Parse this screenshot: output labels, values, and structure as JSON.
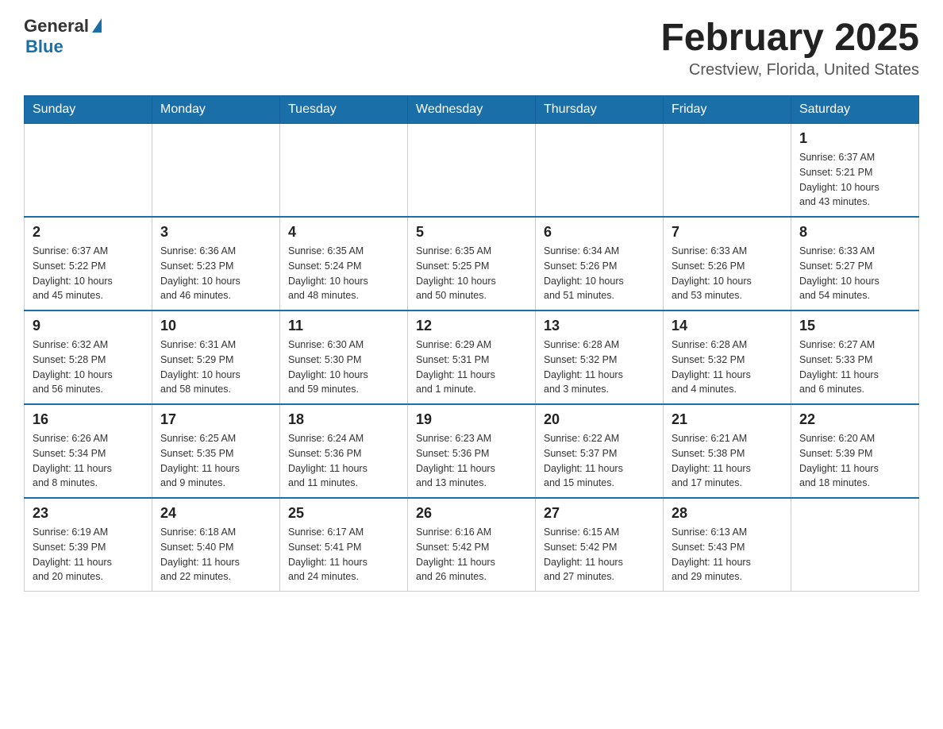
{
  "header": {
    "logo_general": "General",
    "logo_blue": "Blue",
    "month_title": "February 2025",
    "location": "Crestview, Florida, United States"
  },
  "weekdays": [
    "Sunday",
    "Monday",
    "Tuesday",
    "Wednesday",
    "Thursday",
    "Friday",
    "Saturday"
  ],
  "rows": [
    {
      "cells": [
        {
          "day": "",
          "info": ""
        },
        {
          "day": "",
          "info": ""
        },
        {
          "day": "",
          "info": ""
        },
        {
          "day": "",
          "info": ""
        },
        {
          "day": "",
          "info": ""
        },
        {
          "day": "",
          "info": ""
        },
        {
          "day": "1",
          "info": "Sunrise: 6:37 AM\nSunset: 5:21 PM\nDaylight: 10 hours\nand 43 minutes."
        }
      ]
    },
    {
      "cells": [
        {
          "day": "2",
          "info": "Sunrise: 6:37 AM\nSunset: 5:22 PM\nDaylight: 10 hours\nand 45 minutes."
        },
        {
          "day": "3",
          "info": "Sunrise: 6:36 AM\nSunset: 5:23 PM\nDaylight: 10 hours\nand 46 minutes."
        },
        {
          "day": "4",
          "info": "Sunrise: 6:35 AM\nSunset: 5:24 PM\nDaylight: 10 hours\nand 48 minutes."
        },
        {
          "day": "5",
          "info": "Sunrise: 6:35 AM\nSunset: 5:25 PM\nDaylight: 10 hours\nand 50 minutes."
        },
        {
          "day": "6",
          "info": "Sunrise: 6:34 AM\nSunset: 5:26 PM\nDaylight: 10 hours\nand 51 minutes."
        },
        {
          "day": "7",
          "info": "Sunrise: 6:33 AM\nSunset: 5:26 PM\nDaylight: 10 hours\nand 53 minutes."
        },
        {
          "day": "8",
          "info": "Sunrise: 6:33 AM\nSunset: 5:27 PM\nDaylight: 10 hours\nand 54 minutes."
        }
      ]
    },
    {
      "cells": [
        {
          "day": "9",
          "info": "Sunrise: 6:32 AM\nSunset: 5:28 PM\nDaylight: 10 hours\nand 56 minutes."
        },
        {
          "day": "10",
          "info": "Sunrise: 6:31 AM\nSunset: 5:29 PM\nDaylight: 10 hours\nand 58 minutes."
        },
        {
          "day": "11",
          "info": "Sunrise: 6:30 AM\nSunset: 5:30 PM\nDaylight: 10 hours\nand 59 minutes."
        },
        {
          "day": "12",
          "info": "Sunrise: 6:29 AM\nSunset: 5:31 PM\nDaylight: 11 hours\nand 1 minute."
        },
        {
          "day": "13",
          "info": "Sunrise: 6:28 AM\nSunset: 5:32 PM\nDaylight: 11 hours\nand 3 minutes."
        },
        {
          "day": "14",
          "info": "Sunrise: 6:28 AM\nSunset: 5:32 PM\nDaylight: 11 hours\nand 4 minutes."
        },
        {
          "day": "15",
          "info": "Sunrise: 6:27 AM\nSunset: 5:33 PM\nDaylight: 11 hours\nand 6 minutes."
        }
      ]
    },
    {
      "cells": [
        {
          "day": "16",
          "info": "Sunrise: 6:26 AM\nSunset: 5:34 PM\nDaylight: 11 hours\nand 8 minutes."
        },
        {
          "day": "17",
          "info": "Sunrise: 6:25 AM\nSunset: 5:35 PM\nDaylight: 11 hours\nand 9 minutes."
        },
        {
          "day": "18",
          "info": "Sunrise: 6:24 AM\nSunset: 5:36 PM\nDaylight: 11 hours\nand 11 minutes."
        },
        {
          "day": "19",
          "info": "Sunrise: 6:23 AM\nSunset: 5:36 PM\nDaylight: 11 hours\nand 13 minutes."
        },
        {
          "day": "20",
          "info": "Sunrise: 6:22 AM\nSunset: 5:37 PM\nDaylight: 11 hours\nand 15 minutes."
        },
        {
          "day": "21",
          "info": "Sunrise: 6:21 AM\nSunset: 5:38 PM\nDaylight: 11 hours\nand 17 minutes."
        },
        {
          "day": "22",
          "info": "Sunrise: 6:20 AM\nSunset: 5:39 PM\nDaylight: 11 hours\nand 18 minutes."
        }
      ]
    },
    {
      "cells": [
        {
          "day": "23",
          "info": "Sunrise: 6:19 AM\nSunset: 5:39 PM\nDaylight: 11 hours\nand 20 minutes."
        },
        {
          "day": "24",
          "info": "Sunrise: 6:18 AM\nSunset: 5:40 PM\nDaylight: 11 hours\nand 22 minutes."
        },
        {
          "day": "25",
          "info": "Sunrise: 6:17 AM\nSunset: 5:41 PM\nDaylight: 11 hours\nand 24 minutes."
        },
        {
          "day": "26",
          "info": "Sunrise: 6:16 AM\nSunset: 5:42 PM\nDaylight: 11 hours\nand 26 minutes."
        },
        {
          "day": "27",
          "info": "Sunrise: 6:15 AM\nSunset: 5:42 PM\nDaylight: 11 hours\nand 27 minutes."
        },
        {
          "day": "28",
          "info": "Sunrise: 6:13 AM\nSunset: 5:43 PM\nDaylight: 11 hours\nand 29 minutes."
        },
        {
          "day": "",
          "info": ""
        }
      ]
    }
  ]
}
